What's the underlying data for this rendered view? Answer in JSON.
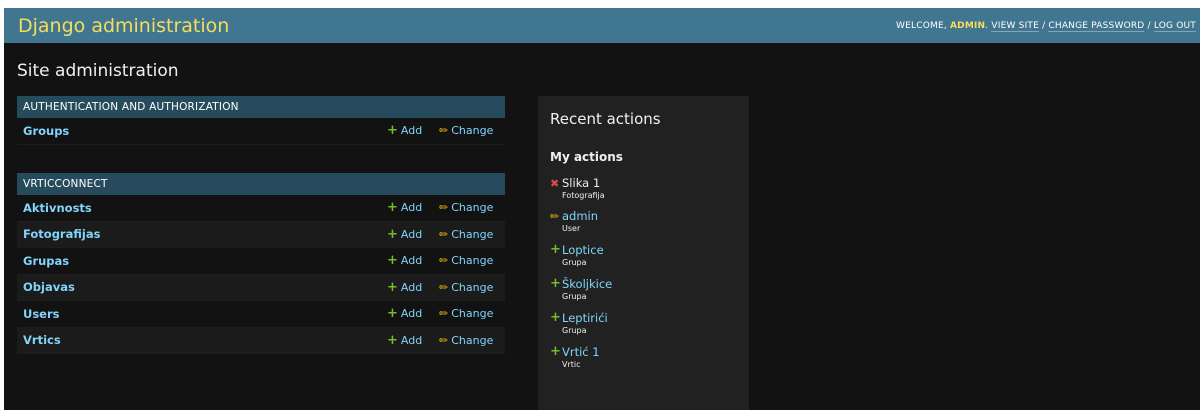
{
  "header": {
    "branding": "Django administration",
    "welcome": "Welcome,",
    "username": "admin",
    "view_site": "View site",
    "change_password": "Change password",
    "log_out": "Log out",
    "sep": " / "
  },
  "page_title": "Site administration",
  "auth_module": {
    "caption": "Authentication and Authorization",
    "models": [
      {
        "name": "Groups"
      }
    ]
  },
  "app_module": {
    "caption": "VrticConnect",
    "models": [
      {
        "name": "Aktivnosts"
      },
      {
        "name": "Fotografijas"
      },
      {
        "name": "Grupas"
      },
      {
        "name": "Objavas"
      },
      {
        "name": "Users"
      },
      {
        "name": "Vrtics"
      }
    ]
  },
  "labels": {
    "add": "Add",
    "change": "Change"
  },
  "recent_actions": {
    "title": "Recent actions",
    "subtitle": "My actions",
    "items": [
      {
        "action": "deletion",
        "name": "Slika 1",
        "type": "Fotografija"
      },
      {
        "action": "change",
        "name": "admin",
        "type": "User"
      },
      {
        "action": "addition",
        "name": "Loptice",
        "type": "Grupa"
      },
      {
        "action": "addition",
        "name": "Školjkice",
        "type": "Grupa"
      },
      {
        "action": "addition",
        "name": "Leptirići",
        "type": "Grupa"
      },
      {
        "action": "addition",
        "name": "Vrtić 1",
        "type": "Vrtic"
      }
    ]
  },
  "colors": {
    "header_bg": "#417690",
    "brand_yellow": "#f5dd5d",
    "caption_bg": "#264b5d",
    "link": "#81d4fa",
    "add_green": "#70bf2b",
    "change_yellow": "#efb80b",
    "delete_red": "#dd4646"
  }
}
